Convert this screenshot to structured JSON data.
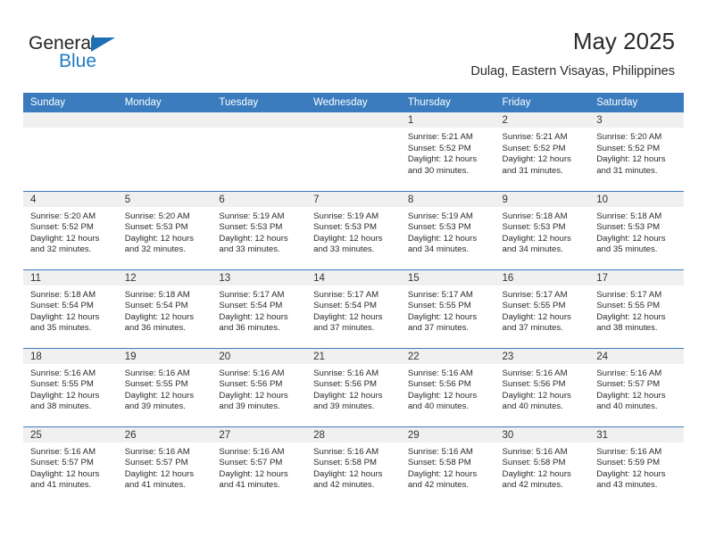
{
  "brand": {
    "name_top": "General",
    "name_bottom": "Blue",
    "triangle_color": "#1f6fb5",
    "bottom_color": "#1f7bc4"
  },
  "header": {
    "title": "May 2025",
    "subtitle": "Dulag, Eastern Visayas, Philippines"
  },
  "theme": {
    "header_bg": "#3a7cbe",
    "header_text": "#ffffff",
    "daynum_bg": "#f0f0f0",
    "row_rule": "#3a7cbe",
    "body_text": "#2b2b2b"
  },
  "weekdays": [
    "Sunday",
    "Monday",
    "Tuesday",
    "Wednesday",
    "Thursday",
    "Friday",
    "Saturday"
  ],
  "labels": {
    "sunrise": "Sunrise:",
    "sunset": "Sunset:",
    "daylight": "Daylight:"
  },
  "weeks": [
    [
      {
        "day": "",
        "sunrise": "",
        "sunset": "",
        "daylight_1": "",
        "daylight_2": "",
        "empty": true
      },
      {
        "day": "",
        "sunrise": "",
        "sunset": "",
        "daylight_1": "",
        "daylight_2": "",
        "empty": true
      },
      {
        "day": "",
        "sunrise": "",
        "sunset": "",
        "daylight_1": "",
        "daylight_2": "",
        "empty": true
      },
      {
        "day": "",
        "sunrise": "",
        "sunset": "",
        "daylight_1": "",
        "daylight_2": "",
        "empty": true
      },
      {
        "day": "1",
        "sunrise": "Sunrise: 5:21 AM",
        "sunset": "Sunset: 5:52 PM",
        "daylight_1": "Daylight: 12 hours",
        "daylight_2": "and 30 minutes."
      },
      {
        "day": "2",
        "sunrise": "Sunrise: 5:21 AM",
        "sunset": "Sunset: 5:52 PM",
        "daylight_1": "Daylight: 12 hours",
        "daylight_2": "and 31 minutes."
      },
      {
        "day": "3",
        "sunrise": "Sunrise: 5:20 AM",
        "sunset": "Sunset: 5:52 PM",
        "daylight_1": "Daylight: 12 hours",
        "daylight_2": "and 31 minutes."
      }
    ],
    [
      {
        "day": "4",
        "sunrise": "Sunrise: 5:20 AM",
        "sunset": "Sunset: 5:52 PM",
        "daylight_1": "Daylight: 12 hours",
        "daylight_2": "and 32 minutes."
      },
      {
        "day": "5",
        "sunrise": "Sunrise: 5:20 AM",
        "sunset": "Sunset: 5:53 PM",
        "daylight_1": "Daylight: 12 hours",
        "daylight_2": "and 32 minutes."
      },
      {
        "day": "6",
        "sunrise": "Sunrise: 5:19 AM",
        "sunset": "Sunset: 5:53 PM",
        "daylight_1": "Daylight: 12 hours",
        "daylight_2": "and 33 minutes."
      },
      {
        "day": "7",
        "sunrise": "Sunrise: 5:19 AM",
        "sunset": "Sunset: 5:53 PM",
        "daylight_1": "Daylight: 12 hours",
        "daylight_2": "and 33 minutes."
      },
      {
        "day": "8",
        "sunrise": "Sunrise: 5:19 AM",
        "sunset": "Sunset: 5:53 PM",
        "daylight_1": "Daylight: 12 hours",
        "daylight_2": "and 34 minutes."
      },
      {
        "day": "9",
        "sunrise": "Sunrise: 5:18 AM",
        "sunset": "Sunset: 5:53 PM",
        "daylight_1": "Daylight: 12 hours",
        "daylight_2": "and 34 minutes."
      },
      {
        "day": "10",
        "sunrise": "Sunrise: 5:18 AM",
        "sunset": "Sunset: 5:53 PM",
        "daylight_1": "Daylight: 12 hours",
        "daylight_2": "and 35 minutes."
      }
    ],
    [
      {
        "day": "11",
        "sunrise": "Sunrise: 5:18 AM",
        "sunset": "Sunset: 5:54 PM",
        "daylight_1": "Daylight: 12 hours",
        "daylight_2": "and 35 minutes."
      },
      {
        "day": "12",
        "sunrise": "Sunrise: 5:18 AM",
        "sunset": "Sunset: 5:54 PM",
        "daylight_1": "Daylight: 12 hours",
        "daylight_2": "and 36 minutes."
      },
      {
        "day": "13",
        "sunrise": "Sunrise: 5:17 AM",
        "sunset": "Sunset: 5:54 PM",
        "daylight_1": "Daylight: 12 hours",
        "daylight_2": "and 36 minutes."
      },
      {
        "day": "14",
        "sunrise": "Sunrise: 5:17 AM",
        "sunset": "Sunset: 5:54 PM",
        "daylight_1": "Daylight: 12 hours",
        "daylight_2": "and 37 minutes."
      },
      {
        "day": "15",
        "sunrise": "Sunrise: 5:17 AM",
        "sunset": "Sunset: 5:55 PM",
        "daylight_1": "Daylight: 12 hours",
        "daylight_2": "and 37 minutes."
      },
      {
        "day": "16",
        "sunrise": "Sunrise: 5:17 AM",
        "sunset": "Sunset: 5:55 PM",
        "daylight_1": "Daylight: 12 hours",
        "daylight_2": "and 37 minutes."
      },
      {
        "day": "17",
        "sunrise": "Sunrise: 5:17 AM",
        "sunset": "Sunset: 5:55 PM",
        "daylight_1": "Daylight: 12 hours",
        "daylight_2": "and 38 minutes."
      }
    ],
    [
      {
        "day": "18",
        "sunrise": "Sunrise: 5:16 AM",
        "sunset": "Sunset: 5:55 PM",
        "daylight_1": "Daylight: 12 hours",
        "daylight_2": "and 38 minutes."
      },
      {
        "day": "19",
        "sunrise": "Sunrise: 5:16 AM",
        "sunset": "Sunset: 5:55 PM",
        "daylight_1": "Daylight: 12 hours",
        "daylight_2": "and 39 minutes."
      },
      {
        "day": "20",
        "sunrise": "Sunrise: 5:16 AM",
        "sunset": "Sunset: 5:56 PM",
        "daylight_1": "Daylight: 12 hours",
        "daylight_2": "and 39 minutes."
      },
      {
        "day": "21",
        "sunrise": "Sunrise: 5:16 AM",
        "sunset": "Sunset: 5:56 PM",
        "daylight_1": "Daylight: 12 hours",
        "daylight_2": "and 39 minutes."
      },
      {
        "day": "22",
        "sunrise": "Sunrise: 5:16 AM",
        "sunset": "Sunset: 5:56 PM",
        "daylight_1": "Daylight: 12 hours",
        "daylight_2": "and 40 minutes."
      },
      {
        "day": "23",
        "sunrise": "Sunrise: 5:16 AM",
        "sunset": "Sunset: 5:56 PM",
        "daylight_1": "Daylight: 12 hours",
        "daylight_2": "and 40 minutes."
      },
      {
        "day": "24",
        "sunrise": "Sunrise: 5:16 AM",
        "sunset": "Sunset: 5:57 PM",
        "daylight_1": "Daylight: 12 hours",
        "daylight_2": "and 40 minutes."
      }
    ],
    [
      {
        "day": "25",
        "sunrise": "Sunrise: 5:16 AM",
        "sunset": "Sunset: 5:57 PM",
        "daylight_1": "Daylight: 12 hours",
        "daylight_2": "and 41 minutes."
      },
      {
        "day": "26",
        "sunrise": "Sunrise: 5:16 AM",
        "sunset": "Sunset: 5:57 PM",
        "daylight_1": "Daylight: 12 hours",
        "daylight_2": "and 41 minutes."
      },
      {
        "day": "27",
        "sunrise": "Sunrise: 5:16 AM",
        "sunset": "Sunset: 5:57 PM",
        "daylight_1": "Daylight: 12 hours",
        "daylight_2": "and 41 minutes."
      },
      {
        "day": "28",
        "sunrise": "Sunrise: 5:16 AM",
        "sunset": "Sunset: 5:58 PM",
        "daylight_1": "Daylight: 12 hours",
        "daylight_2": "and 42 minutes."
      },
      {
        "day": "29",
        "sunrise": "Sunrise: 5:16 AM",
        "sunset": "Sunset: 5:58 PM",
        "daylight_1": "Daylight: 12 hours",
        "daylight_2": "and 42 minutes."
      },
      {
        "day": "30",
        "sunrise": "Sunrise: 5:16 AM",
        "sunset": "Sunset: 5:58 PM",
        "daylight_1": "Daylight: 12 hours",
        "daylight_2": "and 42 minutes."
      },
      {
        "day": "31",
        "sunrise": "Sunrise: 5:16 AM",
        "sunset": "Sunset: 5:59 PM",
        "daylight_1": "Daylight: 12 hours",
        "daylight_2": "and 43 minutes."
      }
    ]
  ]
}
